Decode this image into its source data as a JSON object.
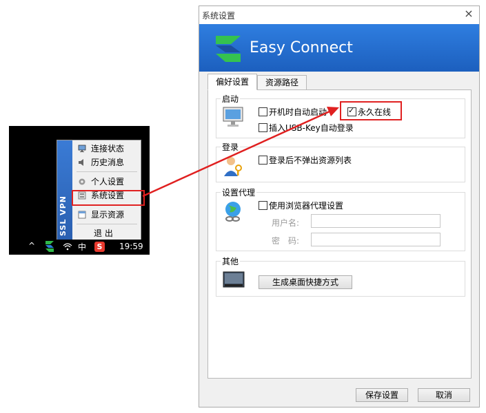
{
  "tray_menu": {
    "band_text": "SSL VPN",
    "items": [
      {
        "label": "连接状态",
        "icon": "monitor-icon"
      },
      {
        "label": "历史消息",
        "icon": "speaker-icon"
      },
      {
        "label": "个人设置",
        "icon": "gear-icon"
      },
      {
        "label": "系统设置",
        "icon": "settings-panel-icon"
      },
      {
        "label": "显示资源",
        "icon": "window-icon"
      },
      {
        "label": "退 出",
        "icon": ""
      }
    ]
  },
  "taskbar": {
    "arrow": "^",
    "ime": "中",
    "sogou": "S",
    "clock": "19:59"
  },
  "dialog": {
    "title": "系统设置",
    "close": "×",
    "brand": "Easy Connect",
    "tabs": [
      "偏好设置",
      "资源路径"
    ],
    "groups": {
      "startup": {
        "title": "启动",
        "options": [
          {
            "label": "开机时自动启动",
            "checked": false
          },
          {
            "label": "永久在线",
            "checked": true
          },
          {
            "label": "插入USB-Key自动登录",
            "checked": false
          }
        ]
      },
      "login": {
        "title": "登录",
        "options": [
          {
            "label": "登录后不弹出资源列表",
            "checked": false
          }
        ]
      },
      "proxy": {
        "title": "设置代理",
        "options": [
          {
            "label": "使用浏览器代理设置",
            "checked": false
          }
        ],
        "username_label": "用户名:",
        "password_label": "密　码:"
      },
      "other": {
        "title": "其他",
        "shortcut_button": "生成桌面快捷方式"
      }
    },
    "buttons": {
      "save": "保存设置",
      "cancel": "取消"
    }
  },
  "colors": {
    "highlight": "#e02020",
    "banner": "#2f7ee0",
    "vpn_band": "#3a7bd5"
  }
}
